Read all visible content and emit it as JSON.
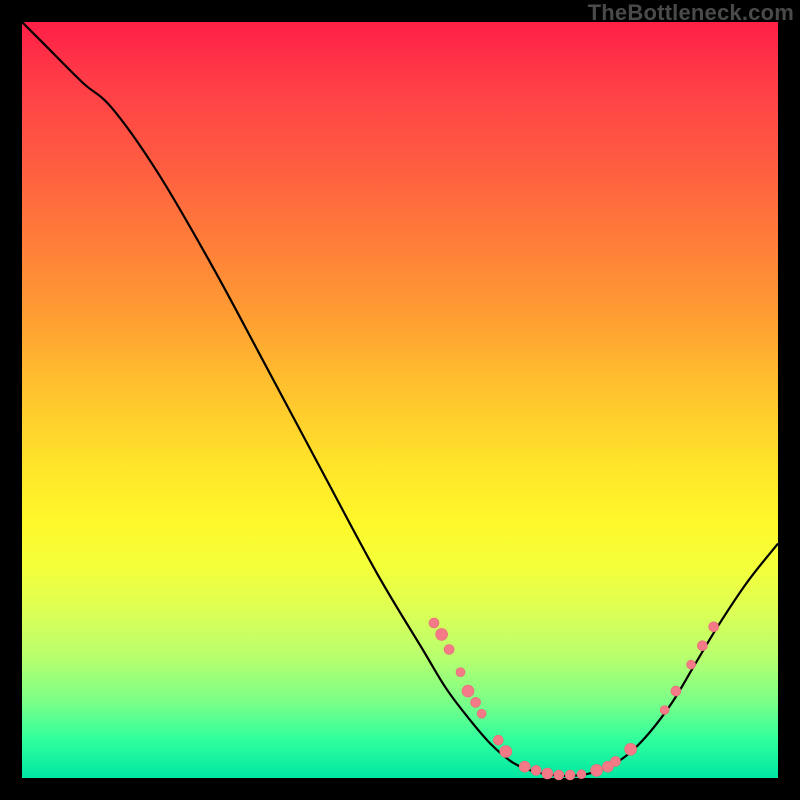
{
  "watermark": "TheBottleneck.com",
  "colors": {
    "curve": "#000000",
    "marker_fill": "#f37a86",
    "marker_stroke": "#e86a78"
  },
  "chart_data": {
    "type": "line",
    "title": "",
    "xlabel": "",
    "ylabel": "",
    "xlim": [
      0,
      100
    ],
    "ylim": [
      0,
      100
    ],
    "curve": [
      {
        "x": 0,
        "y": 100
      },
      {
        "x": 3,
        "y": 97
      },
      {
        "x": 8,
        "y": 92
      },
      {
        "x": 12,
        "y": 88.5
      },
      {
        "x": 18,
        "y": 80
      },
      {
        "x": 25,
        "y": 68
      },
      {
        "x": 32,
        "y": 55
      },
      {
        "x": 40,
        "y": 40
      },
      {
        "x": 47,
        "y": 27
      },
      {
        "x": 53,
        "y": 17
      },
      {
        "x": 56,
        "y": 12
      },
      {
        "x": 59,
        "y": 8
      },
      {
        "x": 62,
        "y": 4.5
      },
      {
        "x": 65,
        "y": 2
      },
      {
        "x": 68,
        "y": 0.8
      },
      {
        "x": 71,
        "y": 0.3
      },
      {
        "x": 74,
        "y": 0.4
      },
      {
        "x": 77,
        "y": 1.2
      },
      {
        "x": 80,
        "y": 3
      },
      {
        "x": 83,
        "y": 6
      },
      {
        "x": 86,
        "y": 10
      },
      {
        "x": 89,
        "y": 15
      },
      {
        "x": 92,
        "y": 20
      },
      {
        "x": 96,
        "y": 26
      },
      {
        "x": 100,
        "y": 31
      }
    ],
    "markers": [
      {
        "x": 54.5,
        "y": 20.5,
        "r": 5
      },
      {
        "x": 55.5,
        "y": 19,
        "r": 6
      },
      {
        "x": 56.5,
        "y": 17,
        "r": 5
      },
      {
        "x": 58,
        "y": 14,
        "r": 4.5
      },
      {
        "x": 59,
        "y": 11.5,
        "r": 6
      },
      {
        "x": 60,
        "y": 10,
        "r": 5
      },
      {
        "x": 60.8,
        "y": 8.5,
        "r": 4.5
      },
      {
        "x": 63,
        "y": 5,
        "r": 5
      },
      {
        "x": 64,
        "y": 3.5,
        "r": 6
      },
      {
        "x": 66.5,
        "y": 1.5,
        "r": 5.5
      },
      {
        "x": 68,
        "y": 1,
        "r": 5
      },
      {
        "x": 69.5,
        "y": 0.6,
        "r": 5.5
      },
      {
        "x": 71,
        "y": 0.4,
        "r": 5
      },
      {
        "x": 72.5,
        "y": 0.4,
        "r": 5
      },
      {
        "x": 74,
        "y": 0.5,
        "r": 4.5
      },
      {
        "x": 76,
        "y": 1,
        "r": 6
      },
      {
        "x": 77.5,
        "y": 1.5,
        "r": 5.5
      },
      {
        "x": 78.5,
        "y": 2.2,
        "r": 5
      },
      {
        "x": 80.5,
        "y": 3.8,
        "r": 6
      },
      {
        "x": 85,
        "y": 9,
        "r": 4.5
      },
      {
        "x": 86.5,
        "y": 11.5,
        "r": 5
      },
      {
        "x": 88.5,
        "y": 15,
        "r": 4.5
      },
      {
        "x": 90,
        "y": 17.5,
        "r": 5
      },
      {
        "x": 91.5,
        "y": 20,
        "r": 5
      }
    ]
  }
}
